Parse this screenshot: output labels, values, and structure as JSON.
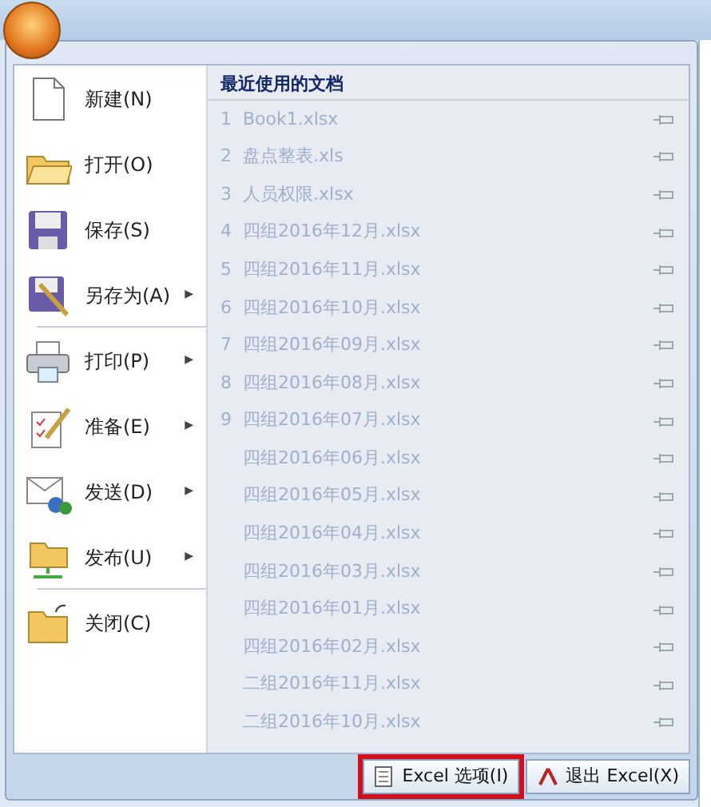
{
  "left_menu": [
    {
      "label": "新建(N)",
      "divider_after": false
    },
    {
      "label": "打开(O)",
      "divider_after": false
    },
    {
      "label": "保存(S)",
      "divider_after": false
    },
    {
      "label": "另存为(A)",
      "arrow": "▶",
      "divider_after": true
    },
    {
      "label": "打印(P)",
      "arrow": "▶",
      "divider_after": false
    },
    {
      "label": "准备(E)",
      "arrow": "▶",
      "divider_after": false
    },
    {
      "label": "发送(D)",
      "arrow": "▶",
      "divider_after": false
    },
    {
      "label": "发布(U)",
      "arrow": "▶",
      "divider_after": true
    },
    {
      "label": "关闭(C)",
      "divider_after": false
    }
  ],
  "recent": {
    "title": "最近使用的文档",
    "files": [
      {
        "number": "1",
        "name": "Book1.xlsx"
      },
      {
        "number": "2",
        "name": "盘点整表.xls"
      },
      {
        "number": "3",
        "name": "人员权限.xlsx"
      },
      {
        "number": "4",
        "name": "四组2016年12月.xlsx"
      },
      {
        "number": "5",
        "name": "四组2016年11月.xlsx"
      },
      {
        "number": "6",
        "name": "四组2016年10月.xlsx"
      },
      {
        "number": "7",
        "name": "四组2016年09月.xlsx"
      },
      {
        "number": "8",
        "name": "四组2016年08月.xlsx"
      },
      {
        "number": "9",
        "name": "四组2016年07月.xlsx"
      },
      {
        "name": "四组2016年06月.xlsx"
      },
      {
        "name": "四组2016年05月.xlsx"
      },
      {
        "name": "四组2016年04月.xlsx"
      },
      {
        "name": "四组2016年03月.xlsx"
      },
      {
        "name": "四组2016年01月.xlsx"
      },
      {
        "name": "四组2016年02月.xlsx"
      },
      {
        "name": "二组2016年11月.xlsx"
      },
      {
        "name": "二组2016年10月.xlsx"
      }
    ]
  },
  "bottom_buttons": [
    {
      "label": "Excel 选项(I)",
      "highlighted": true
    },
    {
      "label": "退出 Excel(X)",
      "highlighted": false
    }
  ]
}
